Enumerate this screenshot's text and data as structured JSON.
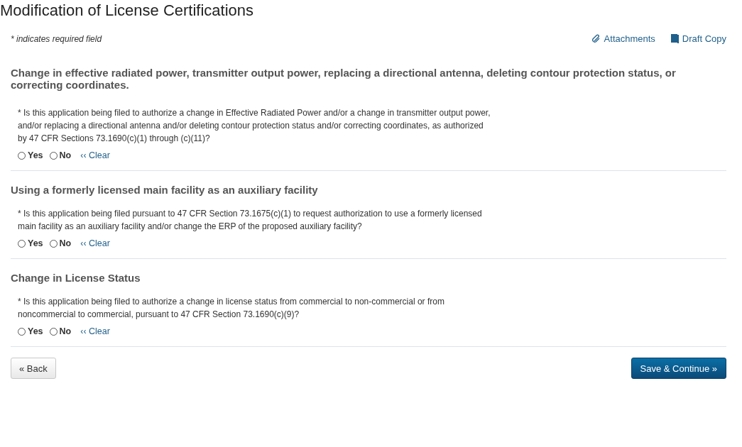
{
  "title": "Modification of License Certifications",
  "required_note": "* indicates required field",
  "links": [
    {
      "kind": "clip",
      "label": "Attachments"
    },
    {
      "kind": "book",
      "label": "Draft Copy"
    }
  ],
  "sections": [
    {
      "heading": "Change in effective radiated power, transmitter output power, replacing a directional antenna, deleting contour protection status, or correcting coordinates.",
      "question": "* Is this application being filed to authorize a change in Effective Radiated Power and/or a change in transmitter output power, and/or replacing a directional antenna and/or deleting contour protection status and/or correcting coordinates, as authorized by 47 CFR Sections 73.1690(c)(1) through (c)(11)?",
      "options": [
        {
          "label": "Yes",
          "selected": false
        },
        {
          "label": "No",
          "selected": false
        }
      ],
      "clear": "‹‹ Clear"
    },
    {
      "heading": "Using a formerly licensed main facility as an auxiliary facility",
      "question": "* Is this application being filed pursuant to 47 CFR Section 73.1675(c)(1) to request authorization to use a formerly licensed main facility as an auxiliary facility and/or change the ERP of the proposed auxiliary facility?",
      "options": [
        {
          "label": "Yes",
          "selected": false
        },
        {
          "label": "No",
          "selected": false
        }
      ],
      "clear": "‹‹ Clear"
    },
    {
      "heading": "Change in License Status",
      "question": "* Is this application being filed to authorize a change in license status from commercial to non-commercial or from noncommercial to commercial, pursuant to 47 CFR Section 73.1690(c)(9)?",
      "options": [
        {
          "label": "Yes",
          "selected": false
        },
        {
          "label": "No",
          "selected": false
        }
      ],
      "clear": "‹‹ Clear"
    }
  ],
  "buttons": {
    "back": "« Back",
    "next": "Save & Continue »"
  }
}
